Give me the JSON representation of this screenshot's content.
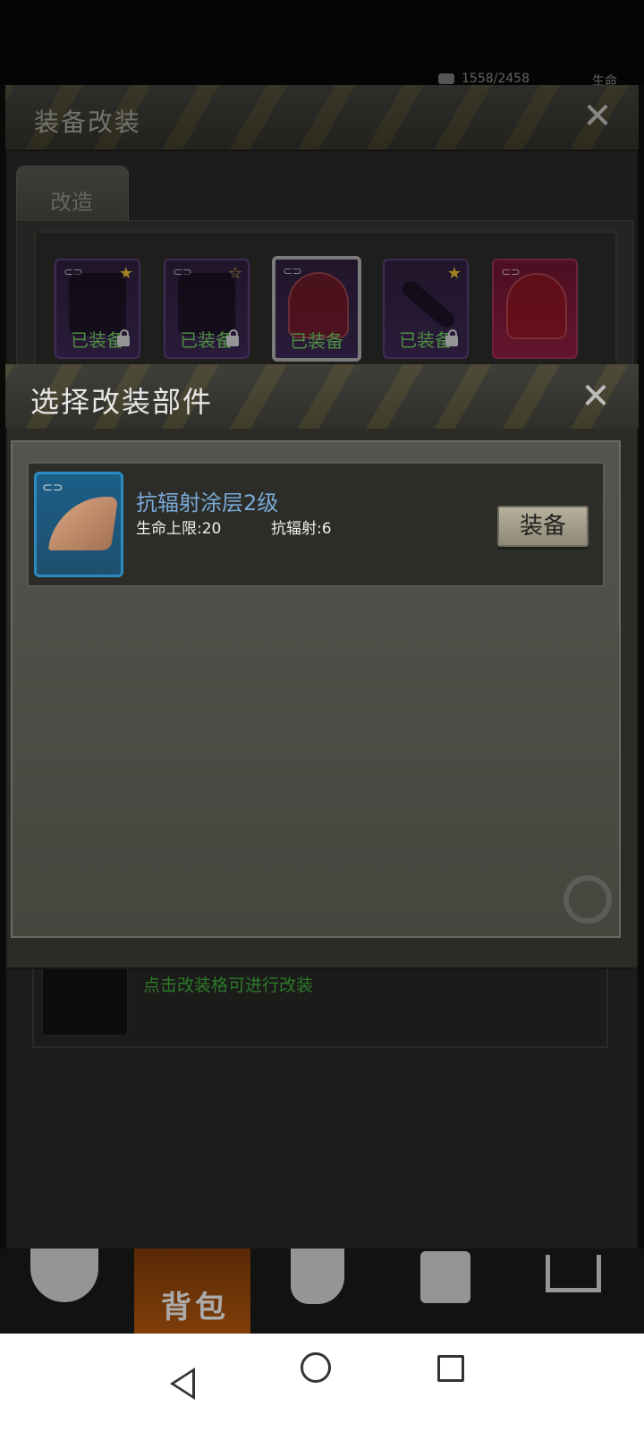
{
  "status": {
    "resource_value": "1558/2458",
    "life_label": "生命"
  },
  "background_window": {
    "title": "装备改装",
    "tab_label": "改造",
    "slots": [
      {
        "label": "已装备",
        "star": true,
        "locked": true,
        "icon": "pants-icon"
      },
      {
        "label": "已装备",
        "star": true,
        "locked": true,
        "icon": "jacket-icon"
      },
      {
        "label": "已装备",
        "star": false,
        "locked": false,
        "icon": "helmet-icon",
        "selected": true
      },
      {
        "label": "已装备",
        "star": true,
        "locked": true,
        "icon": "machete-icon"
      },
      {
        "label": "",
        "star": false,
        "locked": false,
        "icon": "helmet-icon"
      }
    ],
    "hint": "点击改装格可进行改装"
  },
  "bottom_nav": {
    "active_label": "背包"
  },
  "modal": {
    "title": "选择改装部件",
    "item": {
      "name": "抗辐射涂层2级",
      "stat1": "生命上限:20",
      "stat2": "抗辐射:6",
      "equip_label": "装备"
    }
  },
  "colors": {
    "modal_body": "#55554f",
    "item_name": "#7aa9d6",
    "hint_green": "#3fa83a",
    "slot_purple": "#3a2650",
    "slot_red": "#8a1e40",
    "nav_active": "#b0560e"
  }
}
